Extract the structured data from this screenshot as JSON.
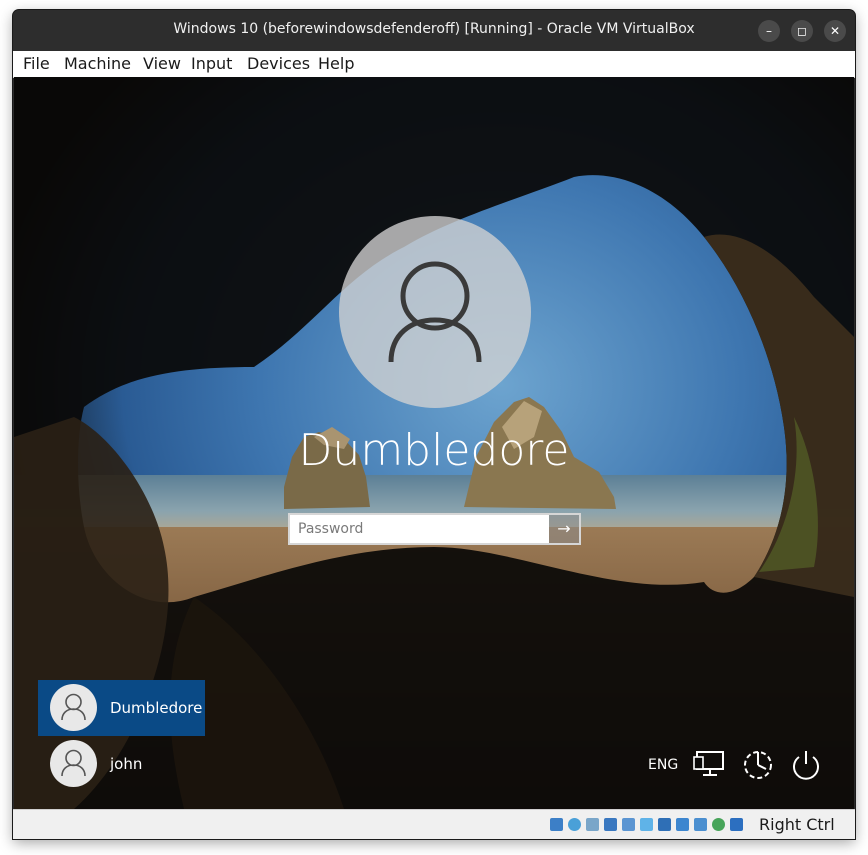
{
  "window": {
    "title": "Windows 10 (beforewindowsdefenderoff) [Running] - Oracle VM VirtualBox",
    "minimize_label": "–",
    "maximize_label": "◻",
    "close_label": "✕"
  },
  "menu": {
    "items": [
      "File",
      "Machine",
      "View",
      "Input",
      "Devices",
      "Help"
    ]
  },
  "login": {
    "username": "Dumbledore",
    "password_placeholder": "Password",
    "password_value": "",
    "submit_glyph": "→"
  },
  "users": [
    {
      "name": "Dumbledore",
      "selected": true
    },
    {
      "name": "john",
      "selected": false
    }
  ],
  "tray": {
    "language": "ENG",
    "icons": [
      "network-icon",
      "ease-of-access-icon",
      "power-icon"
    ]
  },
  "statusbar": {
    "icons": [
      "hard-disk-icon",
      "optical-drive-icon",
      "audio-icon",
      "network-adapter-icon",
      "usb-icon",
      "shared-folders-icon",
      "display-icon",
      "recording-icon",
      "cpu-icon",
      "mouse-integration-icon",
      "keyboard-icon"
    ],
    "host_key": "Right Ctrl"
  },
  "colors": {
    "selected_tile": "#0a4a86",
    "titlebar": "#2d2d2d"
  }
}
